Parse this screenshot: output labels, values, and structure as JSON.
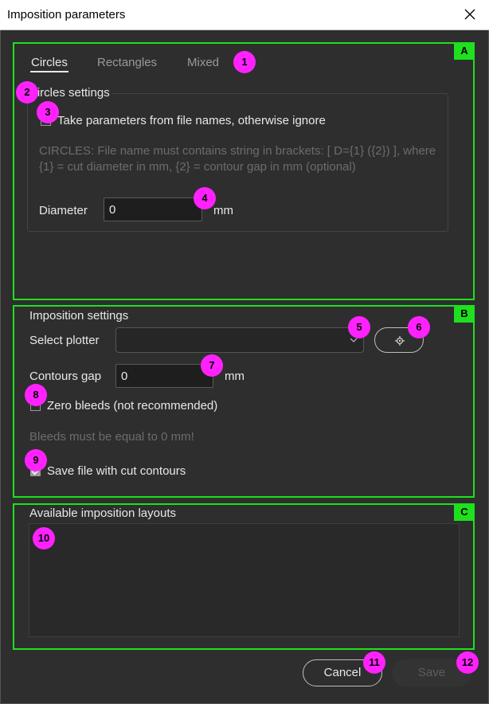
{
  "window": {
    "title": "Imposition parameters"
  },
  "tabs": [
    {
      "label": "Circles",
      "active": true
    },
    {
      "label": "Rectangles",
      "active": false
    },
    {
      "label": "Mixed",
      "active": false
    }
  ],
  "circles": {
    "group_label": "Circles settings",
    "take_params_label": "Take parameters from file names, otherwise ignore",
    "take_params_checked": false,
    "hint": "CIRCLES: File name must contains string in brackets: [ D={1} ({2}) ], where {1} = cut diameter in mm, {2} = contour gap in mm (optional)",
    "diameter_label": "Diameter",
    "diameter_value": "0",
    "diameter_unit": "mm"
  },
  "imposition": {
    "group_label": "Imposition settings",
    "plotter_label": "Select plotter",
    "plotter_value": "",
    "contours_gap_label": "Contours gap",
    "contours_gap_value": "0",
    "contours_gap_unit": "mm",
    "zero_bleeds_label": "Zero bleeds (not recommended)",
    "zero_bleeds_checked": false,
    "bleeds_hint": "Bleeds must be equal to 0 mm!",
    "save_contours_label": "Save file with cut contours",
    "save_contours_checked": true
  },
  "layouts": {
    "group_label": "Available imposition layouts"
  },
  "buttons": {
    "cancel": "Cancel",
    "save": "Save"
  },
  "sections": {
    "a": "A",
    "b": "B",
    "c": "C"
  },
  "markers": [
    "1",
    "2",
    "3",
    "4",
    "5",
    "6",
    "7",
    "8",
    "9",
    "10",
    "11",
    "12"
  ],
  "colors": {
    "section_border": "#1ee01e",
    "marker": "#ff22ff",
    "background": "#2e2e2e"
  }
}
